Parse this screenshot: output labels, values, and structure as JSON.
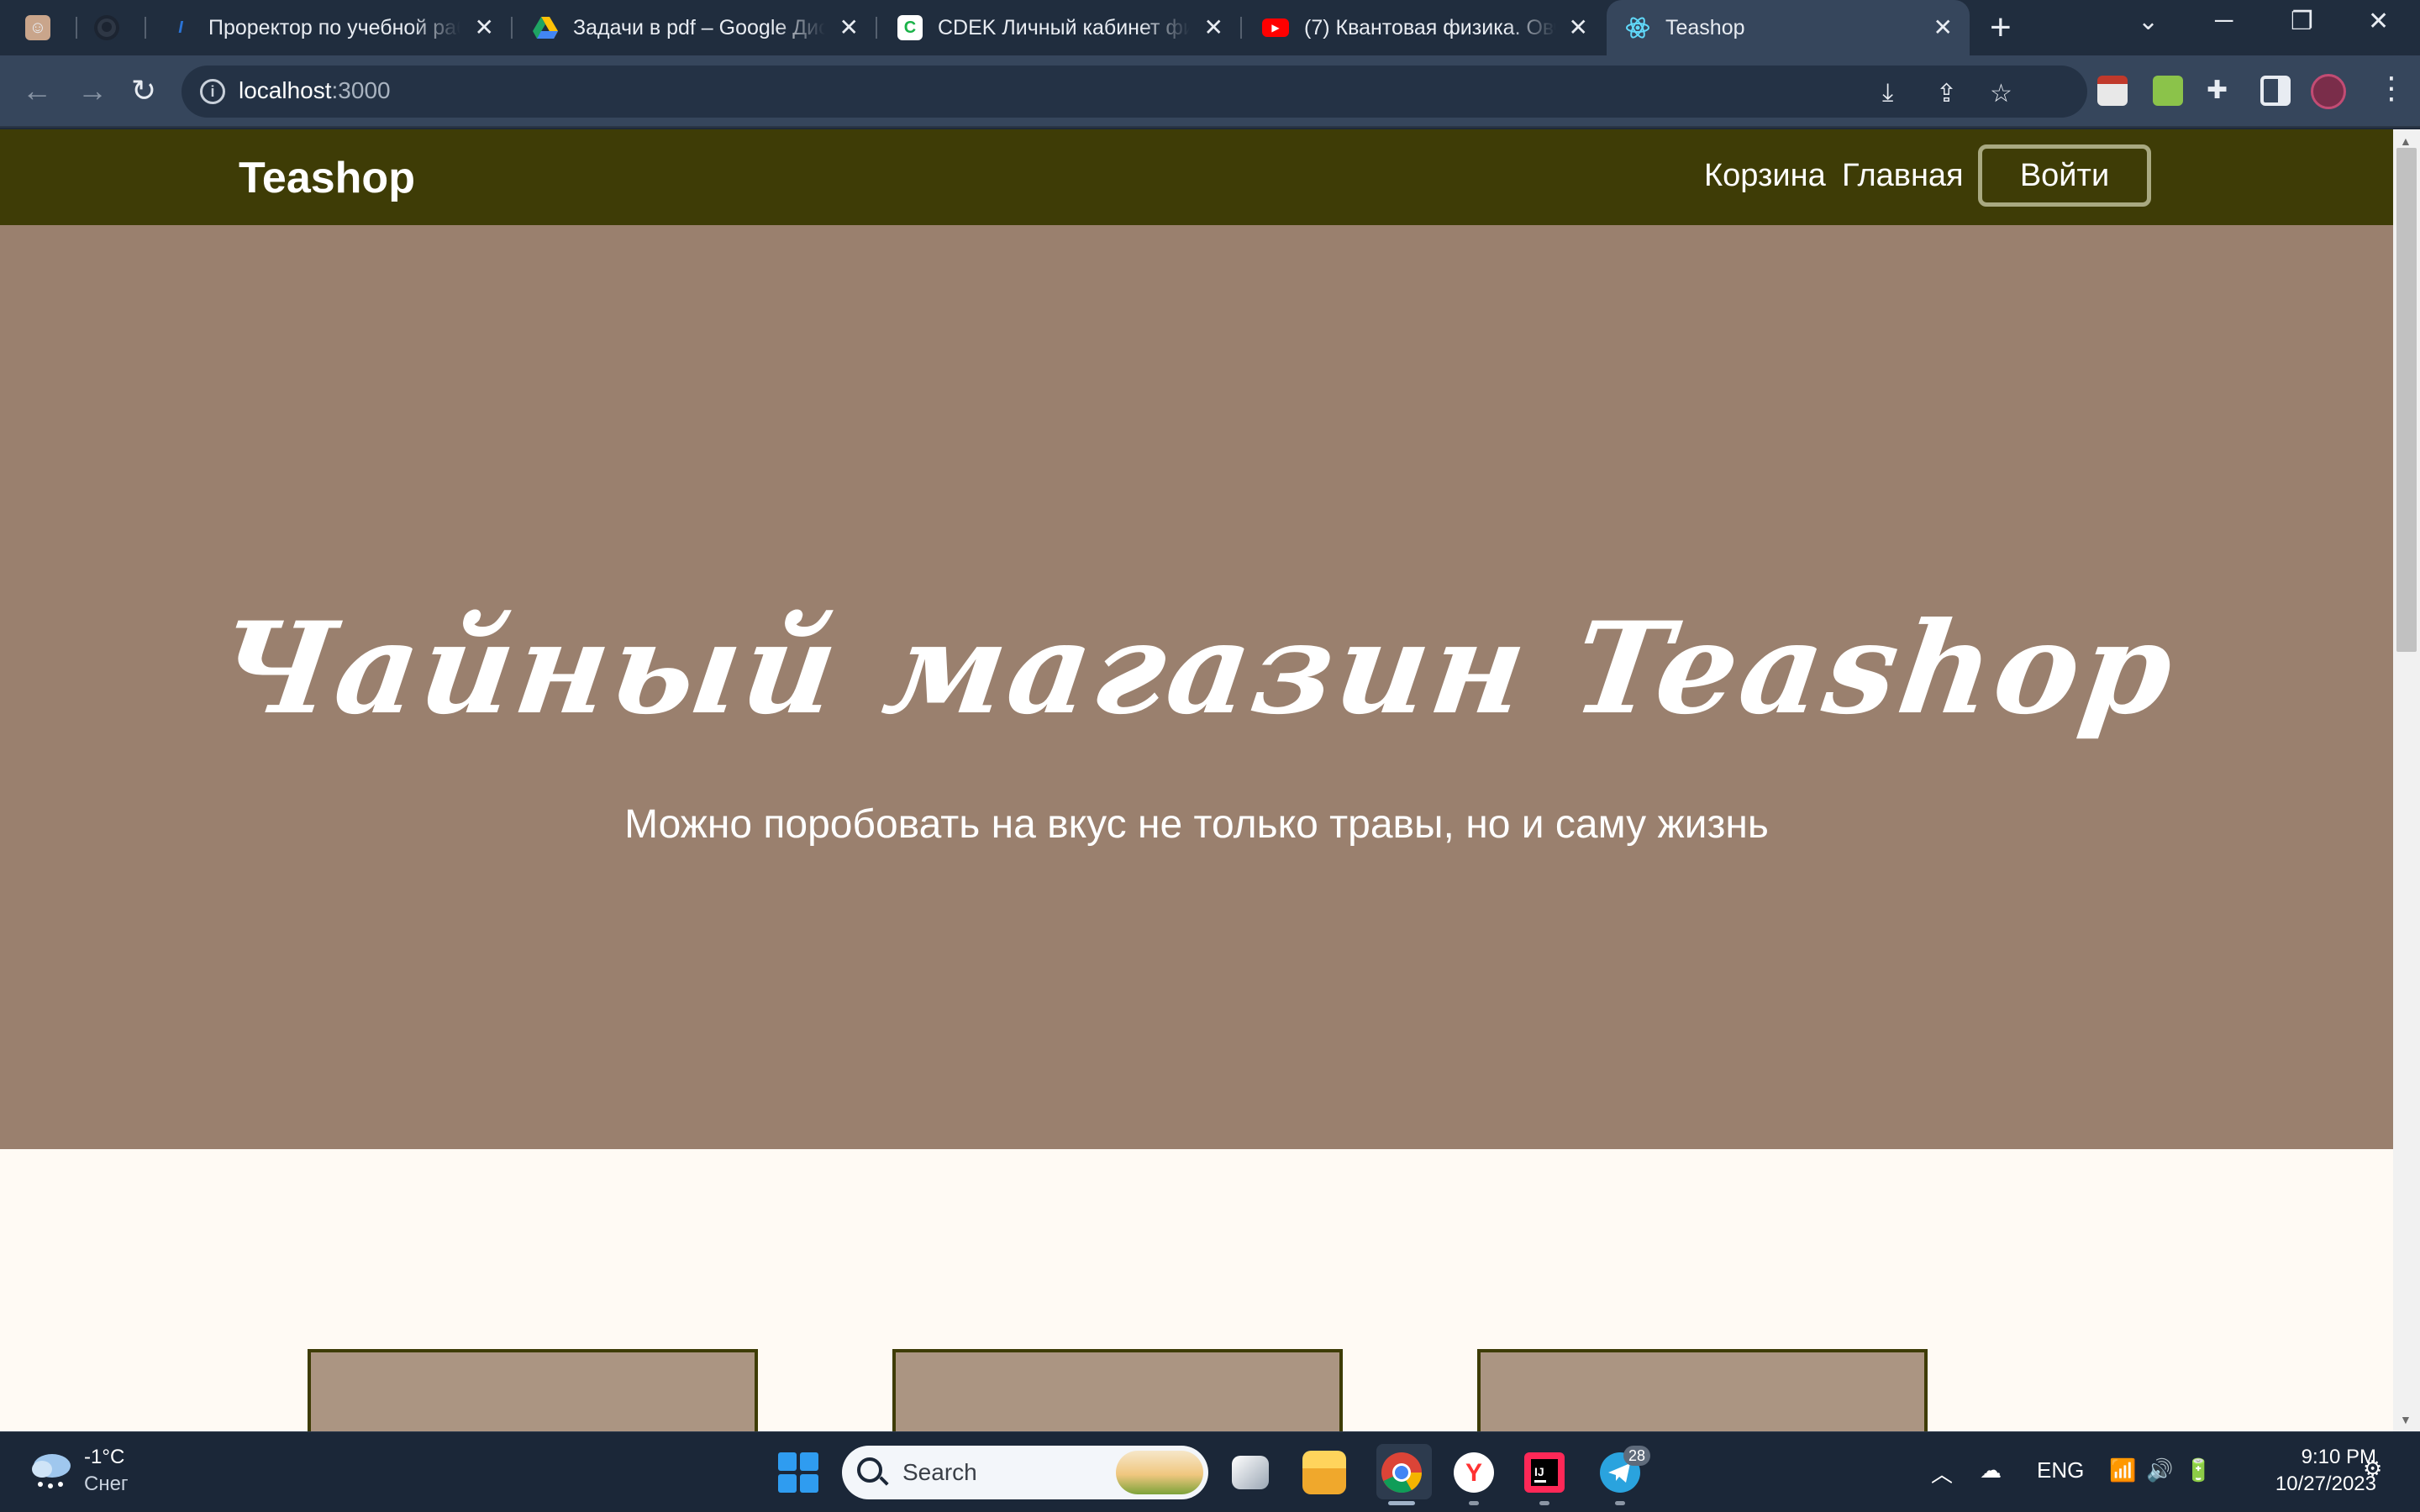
{
  "browser": {
    "tabs": [
      {
        "title": ""
      },
      {
        "title": ""
      },
      {
        "title": "Проректор по учебной раб"
      },
      {
        "title": "Задачи в pdf – Google Диск"
      },
      {
        "title": "CDEK Личный кабинет физ"
      },
      {
        "title": "(7) Квантовая физика. Овчи"
      },
      {
        "title": "Teashop"
      }
    ],
    "new_tab_label": "+",
    "address": {
      "host": "localhost",
      "port": ":3000"
    }
  },
  "site": {
    "brand": "Teashop",
    "nav": {
      "cart": "Корзина",
      "home": "Главная",
      "login": "Войти"
    },
    "hero": {
      "title": "Чайный магазин Teashop",
      "subtitle": "Можно поробовать на вкус не только травы, но и саму жизнь"
    }
  },
  "taskbar": {
    "weather": {
      "temp": "-1°C",
      "desc": "Снег"
    },
    "search_label": "Search",
    "telegram_badge": "28",
    "language": "ENG",
    "time": "9:10 PM",
    "date": "10/27/2023"
  },
  "colors": {
    "header_bg": "#3e3c06",
    "hero_bg": "#9a806e",
    "card_bg": "#ab9582",
    "page_bg": "#fffaf4"
  }
}
